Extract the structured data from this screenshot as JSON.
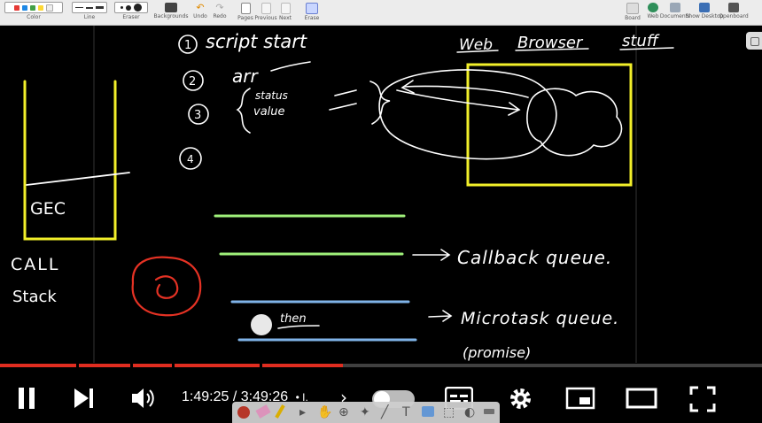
{
  "toolbar": {
    "tools": {
      "color": "Color",
      "line": "Line",
      "eraser": "Eraser",
      "backgrounds": "Backgrounds",
      "undo": "Undo",
      "redo": "Redo",
      "pages": "Pages",
      "previous": "Previous",
      "next": "Next",
      "erase": "Erase"
    },
    "right_tools": {
      "board": "Board",
      "web": "Web",
      "documents": "Documents",
      "show_desktop": "Show Desktop",
      "openboard": "Openboard"
    },
    "swatches": [
      "#e53935",
      "#1e88e5",
      "#43a047",
      "#fdd835",
      "#eeeeee"
    ]
  },
  "whiteboard": {
    "steps": {
      "one": "1",
      "two": "2",
      "three": "3",
      "four": "4"
    },
    "texts": {
      "script_start": "script start",
      "arr": "arr",
      "status": "status",
      "value": "value",
      "web_browser": "Web",
      "browser": "Browser",
      "stuff": "stuff",
      "gec": "GEC",
      "call": "CALL",
      "stack": "Stack",
      "callback_queue": "Callback queue.",
      "microtask_queue": "Microtask queue.",
      "promise": "(promise)",
      "then": "then"
    },
    "colors": {
      "yellow": "#f2ef2a",
      "green": "#9ff07a",
      "blue": "#7fb3e8",
      "red": "#e53224",
      "white": "#ffffff"
    }
  },
  "player": {
    "time_current": "1:49:25",
    "time_separator": " / ",
    "time_total": "3:49:26",
    "chapter_hint": "• I.",
    "played_fraction": 0.45,
    "buffered_fraction": 0.96,
    "icons": {
      "play_pause": "pause-icon",
      "next": "skip-next-icon",
      "volume": "volume-icon",
      "autoplay": "autoplay-toggle-icon",
      "subtitles": "subtitles-icon",
      "settings": "gear-icon",
      "miniplayer": "miniplayer-icon",
      "theater": "theater-mode-icon",
      "fullscreen": "fullscreen-icon"
    }
  }
}
